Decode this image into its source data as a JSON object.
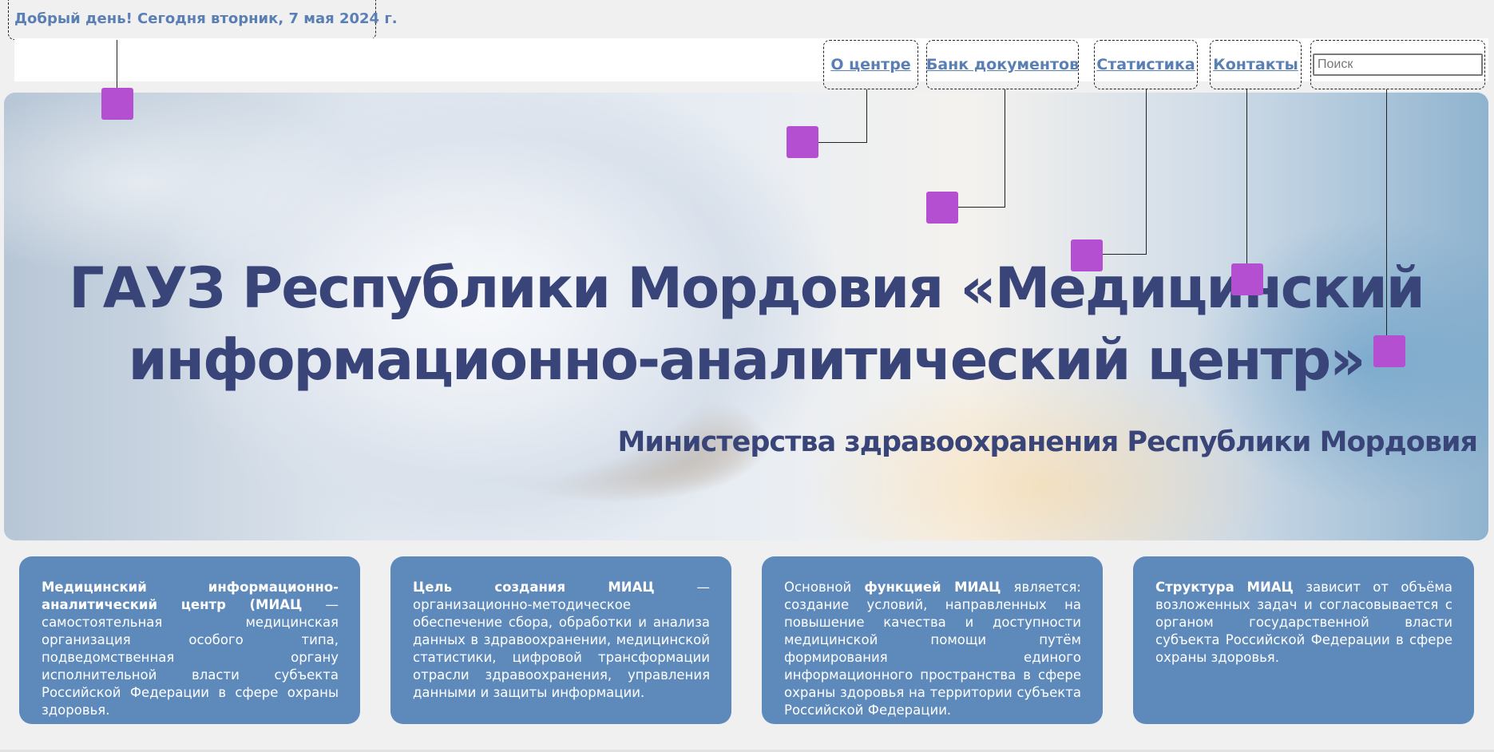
{
  "header": {
    "greeting": "Добрый день! Сегодня вторник, 7 мая 2024 г."
  },
  "nav": {
    "items": [
      {
        "label": "О центре"
      },
      {
        "label": "Банк документов"
      },
      {
        "label": "Статистика"
      },
      {
        "label": "Контакты"
      }
    ],
    "search": {
      "placeholder": "Поиск",
      "value": ""
    }
  },
  "hero": {
    "title": "ГАУЗ Республики Мордовия «Медицинский информационно-аналитический центр»",
    "subtitle": "Министерства здравоохранения Республики Мордовия"
  },
  "cards": [
    {
      "bold": "Медицинский информационно-аналитический центр (МИАЦ",
      "text_before": "",
      "text_after": " — самостоятельная медицинская организация особого типа, подведомственная органу исполнительной власти субъекта Российской Федерации в сфере охраны здоровья."
    },
    {
      "bold": "Цель создания МИАЦ",
      "text_before": "",
      "text_after": " — организационно-методическое обеспечение сбора, обработки и анализа данных в здравоохранении, медицинской статистики, цифровой трансформации отрасли здравоохранения, управления данными и защиты информации."
    },
    {
      "bold": "функцией МИАЦ",
      "text_before": "Основной ",
      "text_after": " является: создание условий, направленных на повышение качества и доступности медицинской помощи путём формирования единого информационного пространства в сфере охраны здоровья на территории субъекта Российской Федерации."
    },
    {
      "bold": "Структура МИАЦ",
      "text_before": "",
      "text_after": " зависит от объёма возложенных задач и согласовывается с органом государственной власти субъекта Российской Федерации в сфере охраны здоровья."
    }
  ],
  "colors": {
    "accent": "#5a7fb5",
    "card_bg": "#5d89bb",
    "title": "#394579",
    "marker": "#b44fd1"
  }
}
